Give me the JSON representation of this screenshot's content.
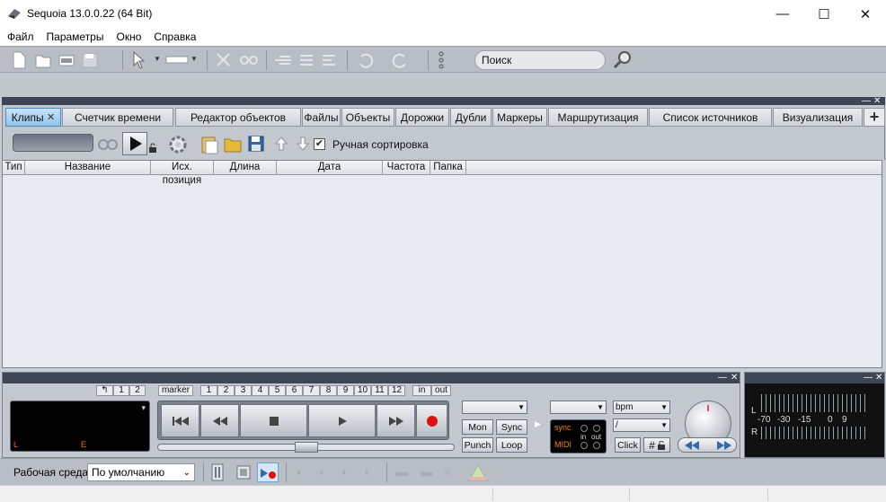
{
  "window": {
    "title": "Sequoia 13.0.0.22 (64 Bit)",
    "minimize_glyph": "—",
    "maximize_glyph": "☐",
    "close_glyph": "✕"
  },
  "menu": [
    "Файл",
    "Параметры",
    "Окно",
    "Справка"
  ],
  "toolbar": {
    "search_placeholder": "Поиск"
  },
  "tabs": [
    {
      "label": "Клипы",
      "active": true,
      "close": "✕"
    },
    {
      "label": "Счетчик времени"
    },
    {
      "label": "Редактор объектов"
    },
    {
      "label": "Файлы"
    },
    {
      "label": "Объекты"
    },
    {
      "label": "Дорожки"
    },
    {
      "label": "Дубли"
    },
    {
      "label": "Маркеры"
    },
    {
      "label": "Маршрутизация"
    },
    {
      "label": "Список источников"
    },
    {
      "label": "Визуализация"
    }
  ],
  "add_tab_glyph": "+",
  "clips": {
    "manual_sort_label": "Ручная сортировка",
    "manual_sort_checked": true,
    "columns": [
      "Тип",
      "Название",
      "Исх. позиция",
      "Длина",
      "Дата",
      "Частота",
      "Папка"
    ]
  },
  "transport": {
    "undo_glyph": "↰",
    "left_markers": [
      "1",
      "2"
    ],
    "marker_label": "marker",
    "markers": [
      "1",
      "2",
      "3",
      "4",
      "5",
      "6",
      "7",
      "8",
      "9",
      "10",
      "11",
      "12"
    ],
    "in_label": "in",
    "out_label": "out",
    "display_left": "L",
    "display_right": "E",
    "display_dropdown": "▾",
    "mon_label": "Mon",
    "sync_label": "Sync",
    "punch_label": "Punch",
    "loop_label": "Loop",
    "sync_text": "sync",
    "midi_text": "MIDI",
    "in_text": "in",
    "out_text": "out",
    "bpm_label": "bpm",
    "meter_sep": "/",
    "click_label": "Click",
    "hash_label": "#"
  },
  "meter": {
    "left_channel": "L",
    "right_channel": "R",
    "scale": [
      "-70",
      "-30",
      "-15",
      "0",
      "9"
    ]
  },
  "bottom": {
    "workspace_label": "Рабочая среда:",
    "workspace_value": "По умолчанию"
  },
  "colors": {
    "accent": "#8fc3ea",
    "panel_header": "#3e4655",
    "record": "#e01010",
    "sync_orange": "#f08a00"
  }
}
